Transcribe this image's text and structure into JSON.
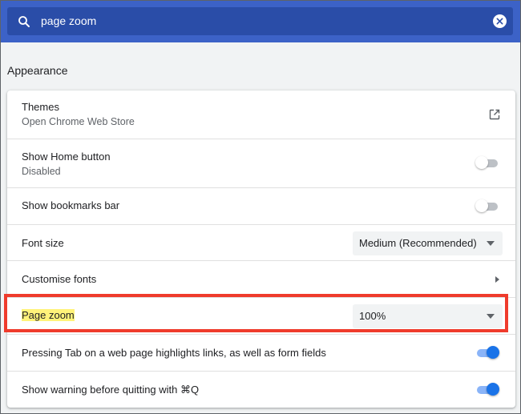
{
  "search": {
    "query": "page zoom",
    "icon": "search-icon",
    "clear_icon": "close-icon"
  },
  "section": {
    "title": "Appearance"
  },
  "settings": {
    "themes": {
      "label": "Themes",
      "sublabel": "Open Chrome Web Store",
      "icon": "external-link-icon"
    },
    "home_button": {
      "label": "Show Home button",
      "sublabel": "Disabled",
      "enabled": false
    },
    "bookmarks_bar": {
      "label": "Show bookmarks bar",
      "enabled": false
    },
    "font_size": {
      "label": "Font size",
      "value": "Medium (Recommended)"
    },
    "customise_fonts": {
      "label": "Customise fonts",
      "icon": "chevron-right-icon"
    },
    "page_zoom": {
      "label": "Page zoom",
      "value": "100%",
      "highlighted": true
    },
    "tab_highlights": {
      "label": "Pressing Tab on a web page highlights links, as well as form fields",
      "enabled": true
    },
    "quit_warning": {
      "label": "Show warning before quitting with ⌘Q",
      "enabled": true
    }
  },
  "colors": {
    "search_band": "#3c62c7",
    "search_box": "#2a4da8",
    "toggle_on": "#1a73e8",
    "highlight": "#fff37a",
    "annotation_box": "#ef3b2c"
  }
}
